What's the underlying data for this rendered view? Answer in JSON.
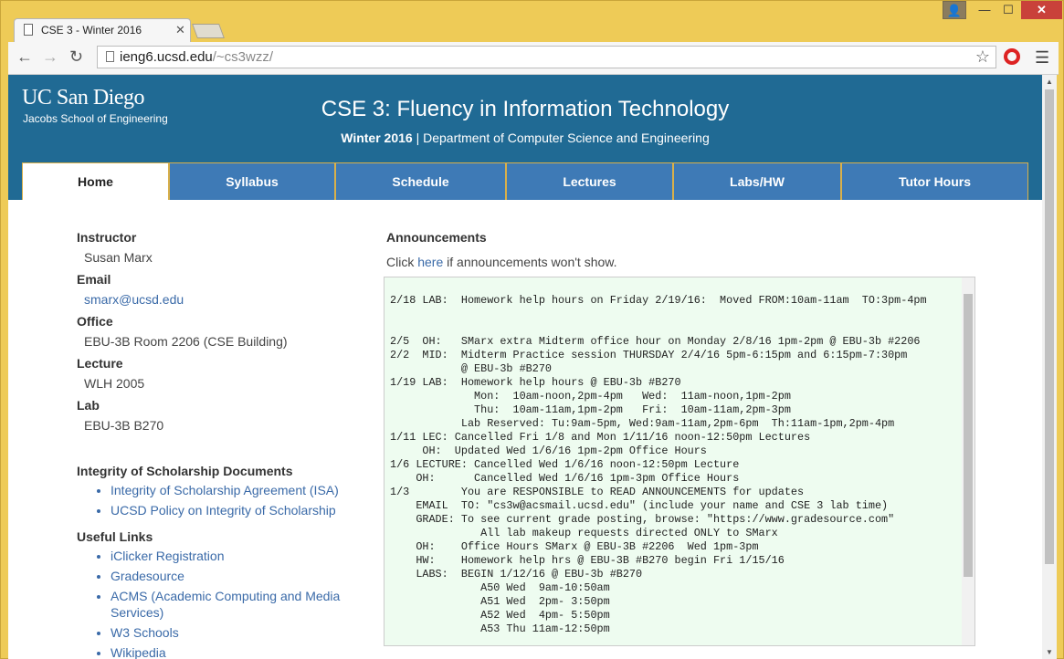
{
  "browser": {
    "tab_title": "CSE 3 - Winter 2016",
    "url_host": "ieng6.ucsd.edu",
    "url_path": "/~cs3wzz/"
  },
  "header": {
    "logo_line1": "UC San Diego",
    "logo_line2": "Jacobs School of Engineering",
    "title": "CSE 3: Fluency in Information Technology",
    "term": "Winter 2016",
    "department": "| Department of Computer Science and Engineering"
  },
  "nav_tabs": [
    {
      "label": "Home"
    },
    {
      "label": "Syllabus"
    },
    {
      "label": "Schedule"
    },
    {
      "label": "Lectures"
    },
    {
      "label": "Labs/HW"
    },
    {
      "label": "Tutor Hours"
    }
  ],
  "sidebar": {
    "instructor_label": "Instructor",
    "instructor": "Susan Marx",
    "email_label": "Email",
    "email": "smarx@ucsd.edu",
    "office_label": "Office",
    "office": "EBU-3B Room 2206 (CSE Building)",
    "lecture_label": "Lecture",
    "lecture": "WLH 2005",
    "lab_label": "Lab",
    "lab": "EBU-3B B270",
    "integrity_title": "Integrity of Scholarship Documents",
    "integrity_links": [
      "Integrity of Scholarship Agreement (ISA)",
      "UCSD Policy on Integrity of Scholarship"
    ],
    "useful_title": "Useful Links",
    "useful_links": [
      "iClicker Registration",
      "Gradesource",
      "ACMS (Academic Computing and Media Services)",
      "W3 Schools",
      "Wikipedia"
    ]
  },
  "announcements": {
    "heading": "Announcements",
    "note_prefix": "Click ",
    "note_link": "here",
    "note_suffix": " if announcements won't show.",
    "text": "2/18 LAB:  Homework help hours on Friday 2/19/16:  Moved FROM:10am-11am  TO:3pm-4pm\n\n\n2/5  OH:   SMarx extra Midterm office hour on Monday 2/8/16 1pm-2pm @ EBU-3b #2206\n2/2  MID:  Midterm Practice session THURSDAY 2/4/16 5pm-6:15pm and 6:15pm-7:30pm\n           @ EBU-3b #B270\n1/19 LAB:  Homework help hours @ EBU-3b #B270\n             Mon:  10am-noon,2pm-4pm   Wed:  11am-noon,1pm-2pm\n             Thu:  10am-11am,1pm-2pm   Fri:  10am-11am,2pm-3pm\n           Lab Reserved: Tu:9am-5pm, Wed:9am-11am,2pm-6pm  Th:11am-1pm,2pm-4pm\n1/11 LEC: Cancelled Fri 1/8 and Mon 1/11/16 noon-12:50pm Lectures\n     OH:  Updated Wed 1/6/16 1pm-2pm Office Hours\n1/6 LECTURE: Cancelled Wed 1/6/16 noon-12:50pm Lecture\n    OH:      Cancelled Wed 1/6/16 1pm-3pm Office Hours\n1/3        You are RESPONSIBLE to READ ANNOUNCEMENTS for updates\n    EMAIL  TO: \"cs3w@acsmail.ucsd.edu\" (include your name and CSE 3 lab time)\n    GRADE: To see current grade posting, browse: \"https://www.gradesource.com\"\n              All lab makeup requests directed ONLY to SMarx\n    OH:    Office Hours SMarx @ EBU-3B #2206  Wed 1pm-3pm\n    HW:    Homework help hrs @ EBU-3B #B270 begin Fri 1/15/16\n    LABS:  BEGIN 1/12/16 @ EBU-3b #B270\n              A50 Wed  9am-10:50am\n              A51 Wed  2pm- 3:50pm\n              A52 Wed  4pm- 5:50pm\n              A53 Thu 11am-12:50pm"
  },
  "icons": [
    "doc-icon",
    "close-icon",
    "back-icon",
    "forward-icon",
    "reload-icon",
    "page-icon",
    "star-icon",
    "opera-icon",
    "menu-icon"
  ]
}
